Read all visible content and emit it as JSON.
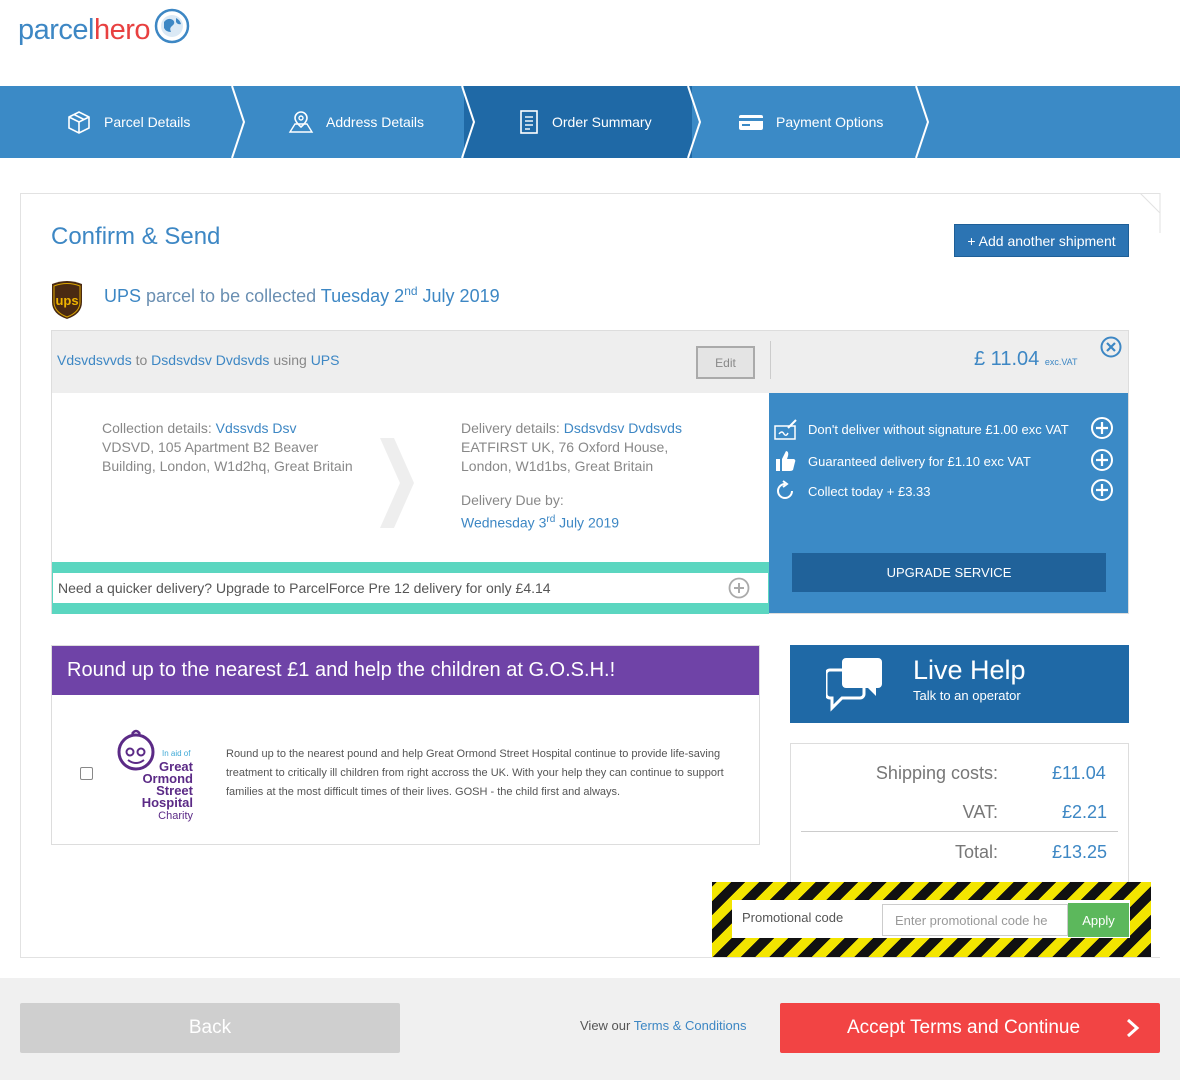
{
  "brand": {
    "part1": "parcel",
    "part2": "hero"
  },
  "steps": [
    {
      "label": "Parcel Details",
      "icon": "box-icon"
    },
    {
      "label": "Address Details",
      "icon": "map-pin-icon"
    },
    {
      "label": "Order Summary",
      "icon": "document-icon",
      "active": true
    },
    {
      "label": "Payment Options",
      "icon": "card-icon"
    }
  ],
  "page": {
    "title": "Confirm & Send",
    "add_shipment": "+ Add another shipment"
  },
  "collection_line": {
    "carrier": "UPS",
    "mid": " parcel to be collected ",
    "date_day": "Tuesday 2",
    "date_sup": "nd",
    "date_rest": " July 2019"
  },
  "shipment": {
    "from": "Vdsvdsvvds",
    "to_word": " to ",
    "to": "Dsdsvdsv Dvdsvds",
    "using_word": " using ",
    "carrier": "UPS",
    "edit_label": "Edit",
    "price": "£ 11.04",
    "price_note": "exc.VAT",
    "collection": {
      "label": "Collection details: ",
      "name": "Vdssvds Dsv",
      "line1": "VDSVD, 105 Apartment B2 Beaver",
      "line2": "Building, London, W1d2hq, Great Britain"
    },
    "delivery": {
      "label": "Delivery details: ",
      "name": "Dsdsvdsv Dvdsvds",
      "line1": "EATFIRST UK, 76 Oxford House,",
      "line2": "London, W1d1bs, Great Britain",
      "due_label": "Delivery Due by:",
      "due_day": "Wednesday 3",
      "due_sup": "rd",
      "due_rest": " July 2019"
    },
    "upgrade_text": "Need a quicker delivery? Upgrade to ParcelForce Pre 12 delivery for only £4.14"
  },
  "extras": [
    {
      "label": "Don't deliver without signature £1.00 exc VAT"
    },
    {
      "label": "Guaranteed delivery for £1.10 exc VAT"
    },
    {
      "label": "Collect today + £3.33"
    }
  ],
  "upgrade_service": "UPGRADE SERVICE",
  "charity": {
    "heading": "Round up to the nearest £1 and help the children at G.O.S.H.!",
    "logo": {
      "aid": "In aid of",
      "l1": "Great",
      "l2": "Ormond",
      "l3": "Street",
      "l4": "Hospital",
      "l5": "Charity"
    },
    "text": "Round up to the nearest pound and help Great Ormond Street Hospital continue to provide life-saving treatment to critically ill children from right accross the UK. With your help they can continue to support families at the most difficult times of their lives. GOSH - the child first and always."
  },
  "live_help": {
    "title": "Live Help",
    "subtitle": "Talk to an operator"
  },
  "totals": {
    "shipping_label": "Shipping costs:",
    "shipping": "£11.04",
    "vat_label": "VAT:",
    "vat": "£2.21",
    "total_label": "Total:",
    "total": "£13.25"
  },
  "promo": {
    "label": "Promotional code",
    "placeholder": "Enter promotional code he",
    "apply": "Apply"
  },
  "footer": {
    "back": "Back",
    "terms_prefix": "View our ",
    "terms_link": "Terms & Conditions",
    "accept": "Accept Terms and Continue"
  }
}
